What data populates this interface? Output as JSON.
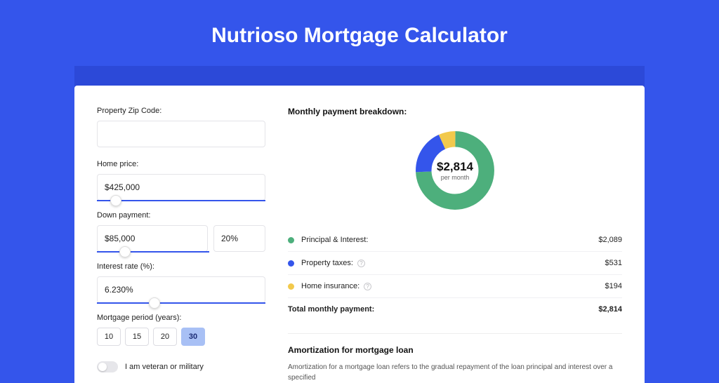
{
  "hero": {
    "title": "Nutrioso Mortgage Calculator"
  },
  "colors": {
    "principal": "#4daf7c",
    "taxes": "#3455eb",
    "insurance": "#f2c94c"
  },
  "form": {
    "zip": {
      "label": "Property Zip Code:",
      "value": ""
    },
    "home_price": {
      "label": "Home price:",
      "value": "$425,000",
      "slider_pct": 8
    },
    "down_payment": {
      "label": "Down payment:",
      "value": "$85,000",
      "percent": "20%",
      "slider_pct": 20
    },
    "interest": {
      "label": "Interest rate (%):",
      "value": "6.230%",
      "slider_pct": 31
    },
    "term": {
      "label": "Mortgage period (years):",
      "options": [
        "10",
        "15",
        "20",
        "30"
      ],
      "selected": "30"
    },
    "veteran": {
      "label": "I am veteran or military",
      "on": false
    }
  },
  "breakdown": {
    "title": "Monthly payment breakdown:",
    "center_amount": "$2,814",
    "center_sub": "per month",
    "items": [
      {
        "name": "Principal & Interest:",
        "value": "$2,089",
        "color": "principal",
        "info": false
      },
      {
        "name": "Property taxes:",
        "value": "$531",
        "color": "taxes",
        "info": true
      },
      {
        "name": "Home insurance:",
        "value": "$194",
        "color": "insurance",
        "info": true
      }
    ],
    "total": {
      "label": "Total monthly payment:",
      "value": "$2,814"
    }
  },
  "amort": {
    "title": "Amortization for mortgage loan",
    "body": "Amortization for a mortgage loan refers to the gradual repayment of the loan principal and interest over a specified"
  },
  "chart_data": {
    "type": "pie",
    "title": "Monthly payment breakdown",
    "series": [
      {
        "name": "Principal & Interest",
        "value": 2089,
        "color": "#4daf7c"
      },
      {
        "name": "Property taxes",
        "value": 531,
        "color": "#3455eb"
      },
      {
        "name": "Home insurance",
        "value": 194,
        "color": "#f2c94c"
      }
    ],
    "total": 2814,
    "center_label": "$2,814 per month"
  }
}
